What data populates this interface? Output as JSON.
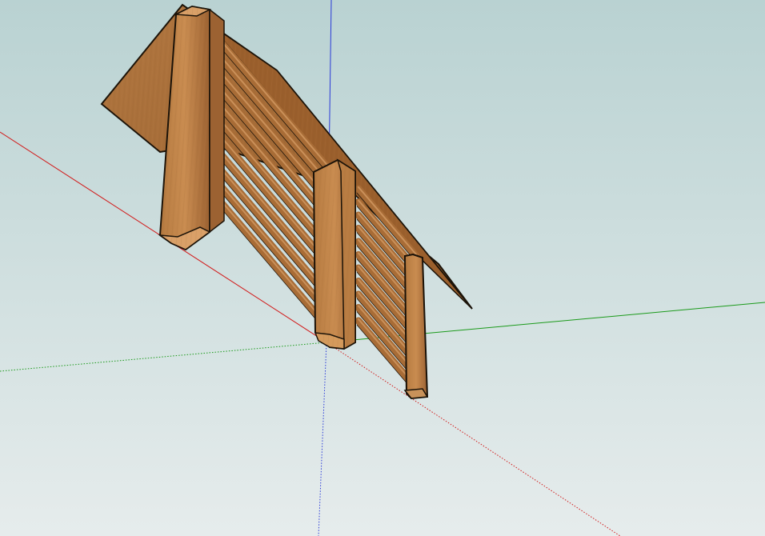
{
  "app": {
    "view": "3d-modeling-viewport",
    "background": {
      "sky_top": "#b9d2d2",
      "sky_bottom": "#e6ecec"
    }
  },
  "axes": {
    "x_axis_color": "#d21a1a",
    "y_axis_color": "#1a9a1a",
    "z_axis_color": "#2a3ad8"
  },
  "model": {
    "object": "slatted-wooden-bench",
    "material": {
      "wood_base": "#a86c36",
      "wood_light": "#c4894c",
      "wood_dark": "#6a3f1a",
      "wood_mid": "#8c5628",
      "edge_color": "#1a1208",
      "highlight": "#d9a068"
    },
    "left_panel_slats": 11,
    "right_panel_slats": 11
  }
}
